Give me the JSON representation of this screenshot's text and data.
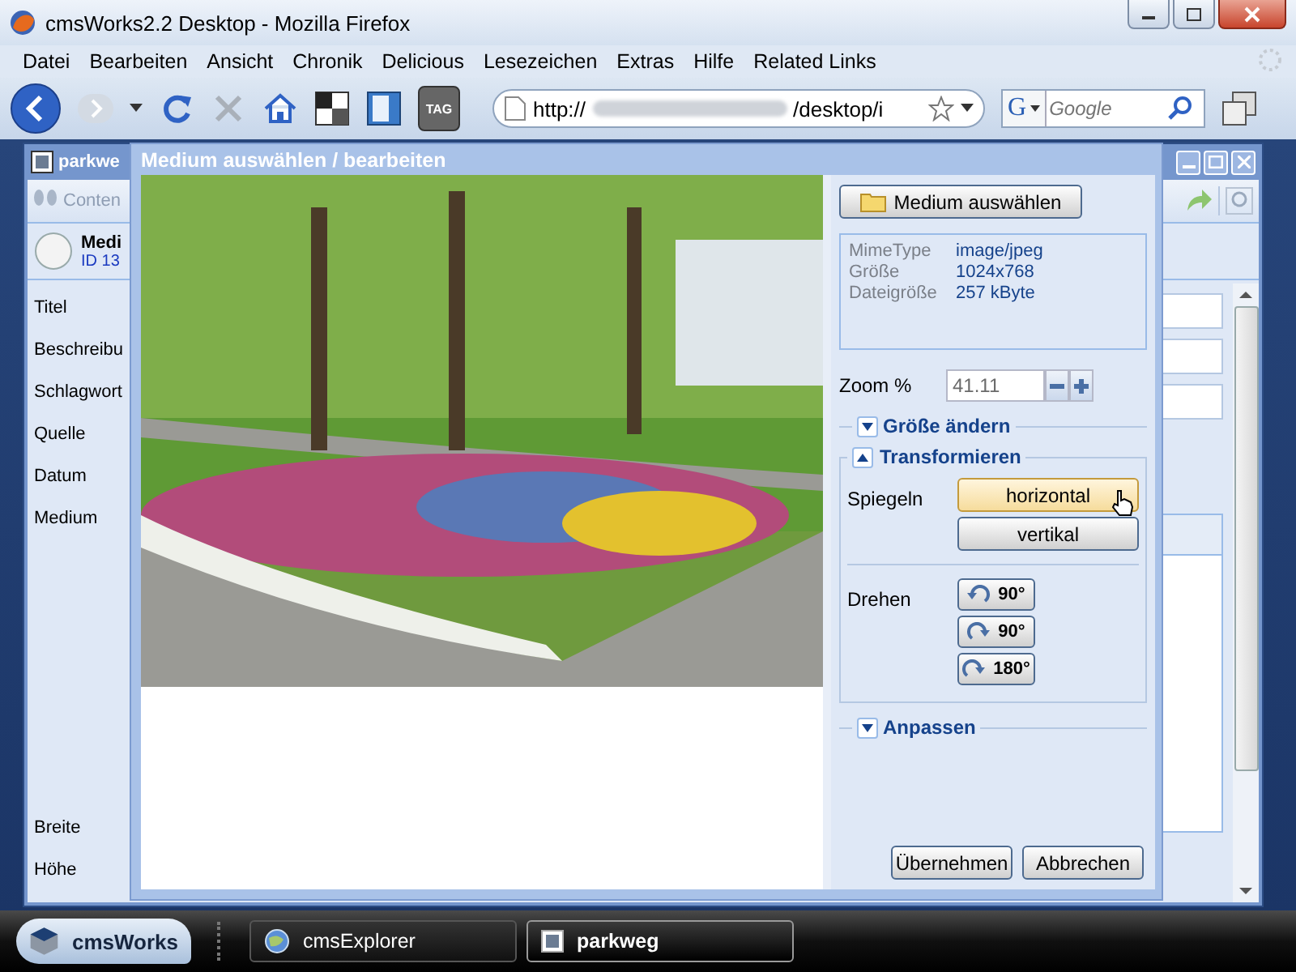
{
  "browser": {
    "title": "cmsWorks2.2 Desktop - Mozilla Firefox",
    "menu": [
      "Datei",
      "Bearbeiten",
      "Ansicht",
      "Chronik",
      "Delicious",
      "Lesezeichen",
      "Extras",
      "Hilfe",
      "Related Links"
    ],
    "tag_label": "TAG",
    "address": {
      "prefix": "http://",
      "suffix": "/desktop/i"
    },
    "search": {
      "engine_letter": "G",
      "placeholder": "Google"
    }
  },
  "background_window": {
    "title": "parkwe",
    "toolbar_label": "Conten",
    "header_title": "Medi",
    "header_id": "ID 13",
    "labels": [
      "Titel",
      "Beschreibu",
      "Schlagwort",
      "Quelle",
      "Datum",
      "Medium"
    ],
    "bottom_labels": [
      "Breite",
      "Höhe"
    ]
  },
  "dialog": {
    "title": "Medium auswählen / bearbeiten",
    "select_button": "Medium auswählen",
    "info": [
      {
        "label": "MimeType",
        "value": "image/jpeg"
      },
      {
        "label": "Größe",
        "value": "1024x768"
      },
      {
        "label": "Dateigröße",
        "value": "257 kByte"
      }
    ],
    "zoom": {
      "label": "Zoom %",
      "value": "41.11"
    },
    "sections": [
      {
        "title": "Größe ändern",
        "expanded": false
      },
      {
        "title": "Transformieren",
        "expanded": true,
        "groups": [
          {
            "label": "Spiegeln",
            "kind": "mirror",
            "buttons": [
              {
                "label": "horizontal",
                "hovered": true
              },
              {
                "label": "vertikal",
                "hovered": false
              }
            ]
          },
          {
            "label": "Drehen",
            "kind": "rotate",
            "buttons": [
              {
                "label": "90°",
                "kind": "rotate_left"
              },
              {
                "label": "90°",
                "kind": "rotate_right"
              },
              {
                "label": "180°",
                "kind": "rotate_right"
              }
            ]
          }
        ]
      },
      {
        "title": "Anpassen",
        "expanded": false
      }
    ],
    "footer_buttons": [
      "Übernehmen",
      "Abbrechen"
    ]
  },
  "taskbar": {
    "start": "cmsWorks",
    "tasks": [
      {
        "label": "cmsExplorer",
        "selected": false
      },
      {
        "label": "parkweg",
        "selected": true
      }
    ]
  }
}
